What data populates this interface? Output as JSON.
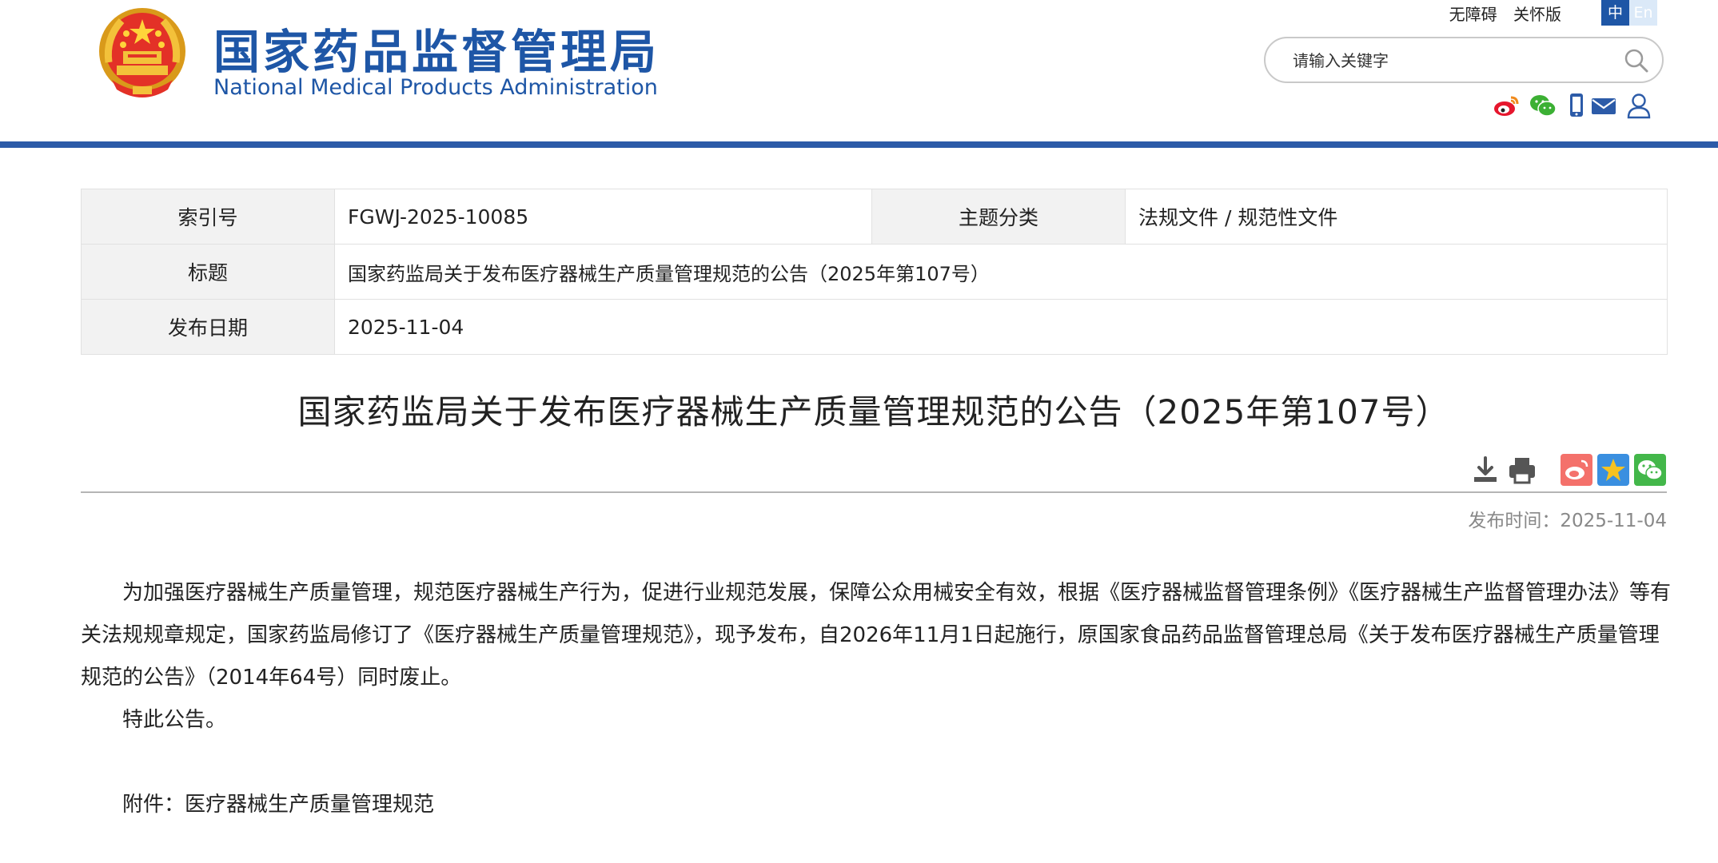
{
  "header": {
    "title_cn": "国家药品监督管理局",
    "title_en": "National Medical Products Administration",
    "top_links": [
      "无障碍",
      "关怀版"
    ],
    "lang_zh": "中",
    "lang_en": "En",
    "search": {
      "placeholder": "请输入关键字",
      "icon": "search-icon"
    },
    "share_icons": [
      "weibo-icon",
      "wechat-icon",
      "mobile-icon",
      "mail-icon",
      "user-icon"
    ],
    "accent_color": "#1e56a6",
    "bar_color": "#2c5ba8"
  },
  "meta": {
    "index_label": "索引号",
    "index_value": "FGWJ-2025-10085",
    "topic_label": "主题分类",
    "topic_value": "法规文件 / 规范性文件",
    "title_label": "标题",
    "title_value": "国家药监局关于发布医疗器械生产质量管理规范的公告（2025年第107号）",
    "date_label": "发布日期",
    "date_value": "2025-11-04"
  },
  "article": {
    "title": "国家药监局关于发布医疗器械生产质量管理规范的公告（2025年第107号）",
    "tool_icons": [
      "download-icon",
      "print-icon",
      "weibo-share-icon",
      "favorite-star-icon",
      "wechat-share-icon"
    ],
    "pub_time_label": "发布时间：",
    "pub_time_value": "2025-11-04",
    "paragraph1": "为加强医疗器械生产质量管理，规范医疗器械生产行为，促进行业规范发展，保障公众用械安全有效，根据《医疗器械监督管理条例》《医疗器械生产监督管理办法》等有关法规规章规定，国家药监局修订了《医疗器械生产质量管理规范》，现予发布，自2026年11月1日起施行，原国家食品药品监督管理总局《关于发布医疗器械生产质量管理规范的公告》（2014年64号）同时废止。",
    "paragraph2": "特此公告。",
    "attachment": "附件：医疗器械生产质量管理规范"
  }
}
